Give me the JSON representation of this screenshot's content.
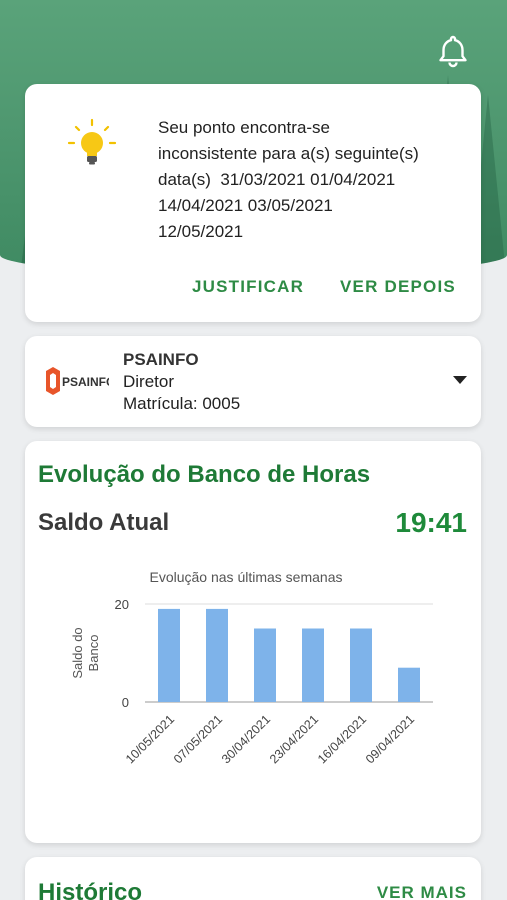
{
  "header": {
    "notifications_icon": "bell-icon"
  },
  "notice": {
    "icon": "lightbulb-icon",
    "lines": [
      "Seu ponto encontra-se",
      "inconsistente para a(s) seguinte(s)",
      "data(s)  31/03/2021 01/04/2021",
      "14/04/2021 03/05/2021",
      "12/05/2021"
    ],
    "justify_label": "JUSTIFICAR",
    "later_label": "VER DEPOIS"
  },
  "company": {
    "logo_text": "PSAINFO",
    "name": "PSAINFO",
    "role": "Diretor",
    "registration": "Matrícula: 0005"
  },
  "bank": {
    "title": "Evolução do Banco de Horas",
    "balance_label": "Saldo Atual",
    "balance_value": "19:41"
  },
  "chart_data": {
    "type": "bar",
    "title": "Evolução nas últimas semanas",
    "ylabel": "Saldo do Banco",
    "xlabel": "",
    "categories": [
      "10/05/2021",
      "07/05/2021",
      "30/04/2021",
      "23/04/2021",
      "16/04/2021",
      "09/04/2021"
    ],
    "values": [
      19,
      19,
      15,
      15,
      15,
      7
    ],
    "yticks": [
      0,
      20
    ],
    "ylim": [
      0,
      20
    ],
    "grid": true,
    "bar_color": "#7eb3ea"
  },
  "history": {
    "title": "Histórico",
    "more_label": "VER MAIS"
  }
}
